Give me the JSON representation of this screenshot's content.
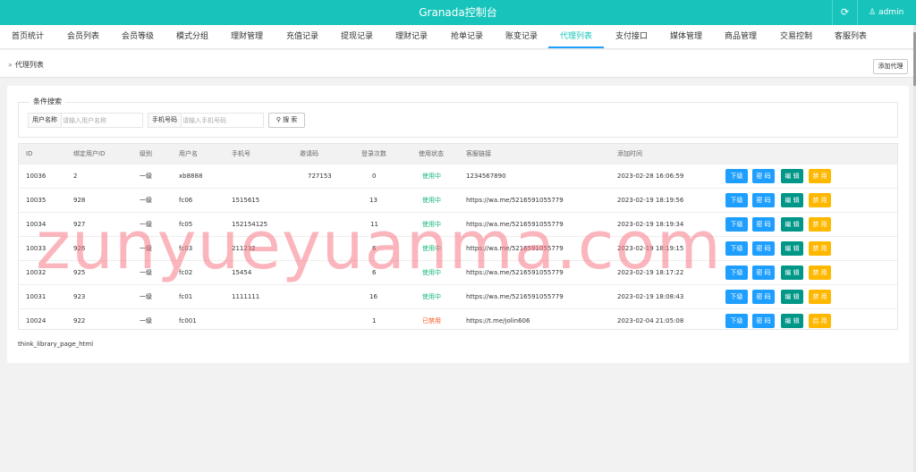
{
  "header": {
    "title": "Granada控制台",
    "refresh_icon": "refresh-icon",
    "user_icon": "user-icon",
    "user_name": "admin",
    "accent_color": "#17c4bb"
  },
  "nav": {
    "items": [
      {
        "label": "首页统计"
      },
      {
        "label": "会员列表"
      },
      {
        "label": "会员等级"
      },
      {
        "label": "模式分组"
      },
      {
        "label": "理财管理"
      },
      {
        "label": "充值记录"
      },
      {
        "label": "提现记录"
      },
      {
        "label": "理财记录"
      },
      {
        "label": "抢单记录"
      },
      {
        "label": "账变记录"
      },
      {
        "label": "代理列表"
      },
      {
        "label": "支付接口"
      },
      {
        "label": "媒体管理"
      },
      {
        "label": "商品管理"
      },
      {
        "label": "交易控制"
      },
      {
        "label": "客服列表"
      }
    ],
    "active": "代理列表"
  },
  "breadcrumb": {
    "arrow": "»",
    "current": "代理列表"
  },
  "toolbar": {
    "add_label": "添加代理"
  },
  "search": {
    "legend": "条件搜索",
    "username_label": "用户名称",
    "username_placeholder": "请输入用户名称",
    "phone_label": "手机号码",
    "phone_placeholder": "请输入手机号码",
    "search_icon": "search-icon",
    "search_label": "搜 索"
  },
  "table": {
    "headers": [
      "ID",
      "绑定用户ID",
      "级别",
      "用户名",
      "手机号",
      "邀请码",
      "登录次数",
      "使用状态",
      "客服链接",
      "添加时间"
    ],
    "rows": [
      {
        "id": "10036",
        "bind_uid": "2",
        "level": "一级",
        "username": "xb8888",
        "phone": "",
        "invite": "727153",
        "logins": "0",
        "status": "使用中",
        "link": "1234567890",
        "time": "2023-02-28 16:06:59",
        "status_type": "on"
      },
      {
        "id": "10035",
        "bind_uid": "928",
        "level": "一级",
        "username": "fc06",
        "phone": "1515615",
        "invite": "",
        "logins": "13",
        "status": "使用中",
        "link": "https://wa.me/5216591055779",
        "time": "2023-02-19 18:19:56",
        "status_type": "on"
      },
      {
        "id": "10034",
        "bind_uid": "927",
        "level": "一级",
        "username": "fc05",
        "phone": "152154125",
        "invite": "",
        "logins": "11",
        "status": "使用中",
        "link": "https://wa.me/5216591055779",
        "time": "2023-02-19 18:19:34",
        "status_type": "on"
      },
      {
        "id": "10033",
        "bind_uid": "926",
        "level": "一级",
        "username": "fc03",
        "phone": "211232",
        "invite": "",
        "logins": "6",
        "status": "使用中",
        "link": "https://wa.me/5216591055779",
        "time": "2023-02-19 18:19:15",
        "status_type": "on"
      },
      {
        "id": "10032",
        "bind_uid": "925",
        "level": "一级",
        "username": "fc02",
        "phone": "15454",
        "invite": "",
        "logins": "6",
        "status": "使用中",
        "link": "https://wa.me/5216591055779",
        "time": "2023-02-19 18:17:22",
        "status_type": "on"
      },
      {
        "id": "10031",
        "bind_uid": "923",
        "level": "一级",
        "username": "fc01",
        "phone": "1111111",
        "invite": "",
        "logins": "16",
        "status": "使用中",
        "link": "https://wa.me/5216591055779",
        "time": "2023-02-19 18:08:43",
        "status_type": "on"
      },
      {
        "id": "10024",
        "bind_uid": "922",
        "level": "一级",
        "username": "fc001",
        "phone": "",
        "invite": "",
        "logins": "1",
        "status": "已禁用",
        "link": "https://t.me/jolin606",
        "time": "2023-02-04 21:05:08",
        "status_type": "off"
      }
    ],
    "actions": {
      "down": "下级",
      "code": "密 码",
      "edit": "编 辑",
      "ban": "禁 用",
      "enable": "启 用"
    },
    "colors": {
      "status_on": "#16b777",
      "status_off": "#ff5722",
      "btn_blue": "#1e9fff",
      "btn_teal": "#009688",
      "btn_orange": "#ffb800"
    }
  },
  "pager": {
    "text": "think_library_page_html"
  },
  "watermark": {
    "text": "zunyueyuanma.com"
  }
}
